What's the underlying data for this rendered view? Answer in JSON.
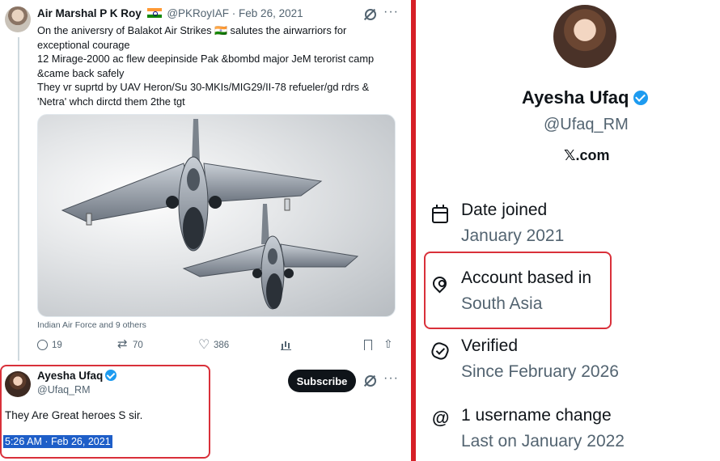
{
  "tweet": {
    "author_name": "Air Marshal P K Roy",
    "handle_date": "@PKRoyIAF · Feb 26, 2021",
    "lines": [
      "On the aniversry of Balakot Air Strikes 🇮🇳 salutes the airwarriors for",
      "exceptional courage",
      "12 Mirage-2000 ac flew deepinside Pak &bombd major JeM terorist camp",
      "&came back safely",
      "They vr suprtd by UAV Heron/Su 30-MKIs/MIG29/II-78 refueler/gd rdrs &",
      "'Netra' whch dirctd them 2the tgt"
    ],
    "media_caption": "Indian Air Force and 9 others",
    "replies": "19",
    "reposts": "70",
    "likes": "386",
    "more": "···"
  },
  "reply": {
    "author_name": "Ayesha Ufaq",
    "handle": "@Ufaq_RM",
    "subscribe_label": "Subscribe",
    "text": "They Are  Great heroes S sir.",
    "timestamp": "5:26 AM · Feb 26, 2021",
    "more": "···"
  },
  "profile": {
    "name": "Ayesha Ufaq",
    "handle": "@Ufaq_RM",
    "site": "𝕏.com",
    "rows": [
      {
        "title": "Date joined",
        "sub": "January 2021",
        "icon": "calendar-icon"
      },
      {
        "title": "Account based in",
        "sub": "South Asia",
        "icon": "location-pin-icon"
      },
      {
        "title": "Verified",
        "sub": "Since February 2026",
        "icon": "verified-badge-icon"
      },
      {
        "title": "1 username change",
        "sub": "Last on January 2022",
        "icon": "at-sign-icon"
      }
    ]
  },
  "colors": {
    "highlight_red": "#d9303a",
    "verified_blue": "#1d9bf0",
    "selection_blue": "#1e5ec8"
  }
}
